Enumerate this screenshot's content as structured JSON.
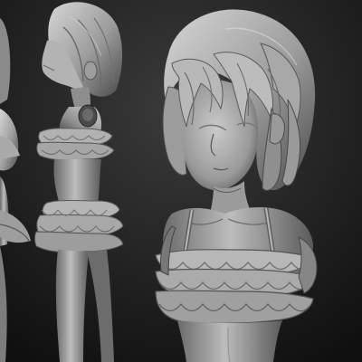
{
  "viewport": {
    "background_colors": [
      "#3b3b3b",
      "#101010"
    ],
    "clay_colors": {
      "light": "#cfcfcf",
      "mid": "#9a9a9a",
      "dark": "#555555",
      "shadow": "#2a2a2a"
    }
  }
}
